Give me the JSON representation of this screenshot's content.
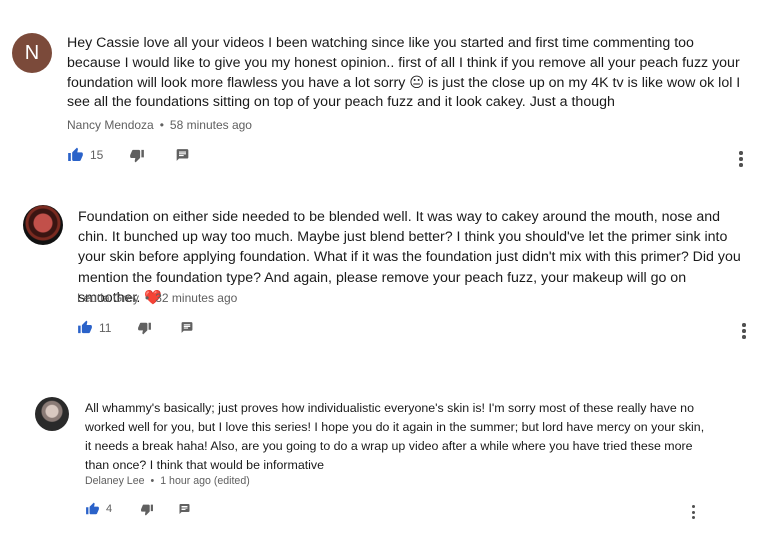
{
  "comments": [
    {
      "avatar_letter": "N",
      "avatar_color": "#7b4a3a",
      "text_before_emoji": "Hey Cassie love all your videos I been watching since like you started and first time commenting too because I would like to give you my honest opinion.. first of all I think if you remove all your peach fuzz your foundation will look more flawless you have a lot sorry",
      "emoji": "😐",
      "text_after_emoji": " is just the close up on my 4K tv is like wow ok lol I see all the foundations sitting on top of your peach fuzz and it look cakey. Just a though",
      "author": "Nancy Mendoza",
      "separator": "•",
      "time": "58 minutes ago",
      "likes": "15"
    },
    {
      "avatar_letter": "",
      "text": "Foundation on either side needed to be blended well. It was way to cakey around the mouth, nose and chin. It bunched up way too much. Maybe just blend better? I think you should've let the primer sink into your skin before applying foundation. What if it was the foundation just didn't mix with this primer? Did you mention the foundation type? And again, please remove your peach fuzz, your makeup will go on smoother.",
      "emoji": "❤️",
      "author": "Leutia Grey",
      "separator": "•",
      "time": "32 minutes ago",
      "likes": "11"
    },
    {
      "avatar_letter": "",
      "text": "All whammy's basically; just proves how individualistic everyone's skin is! I'm sorry most of these really have no worked well for you, but I love this series! I hope you do it again in the summer; but lord have mercy on your skin, it needs a break haha! Also, are you going to do a wrap up video after a while where you have tried these more than once? I think that would be informative",
      "author": "Delaney Lee",
      "separator": "•",
      "time": "1 hour ago (edited)",
      "likes": "4"
    }
  ],
  "icons": {
    "like": "thumb-up-icon",
    "dislike": "thumb-down-icon",
    "reply": "reply-icon",
    "more": "more-vert-icon"
  },
  "colors": {
    "like_blue": "#2a62c9",
    "icon_gray": "#606060"
  }
}
